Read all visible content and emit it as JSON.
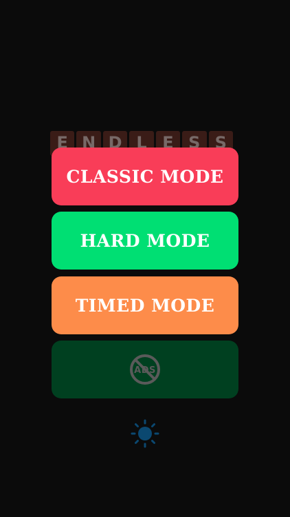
{
  "background_color": "#0b0b0b",
  "title_tiles": {
    "letters": [
      "E",
      "N",
      "D",
      "L",
      "E",
      "S",
      "S"
    ],
    "tile_color": "#3a1c17"
  },
  "buttons": {
    "classic": {
      "label": "CLASSIC MODE",
      "color": "#f93d58"
    },
    "hard": {
      "label": "HARD MODE",
      "color": "#00df73"
    },
    "timed": {
      "label": "TIMED MODE",
      "color": "#fd8c4a"
    },
    "no_ads": {
      "label": "ADS",
      "color": "#004020",
      "icon": "no-ads-icon"
    }
  },
  "settings": {
    "icon": "brightness-icon",
    "color": "#0b4870"
  }
}
